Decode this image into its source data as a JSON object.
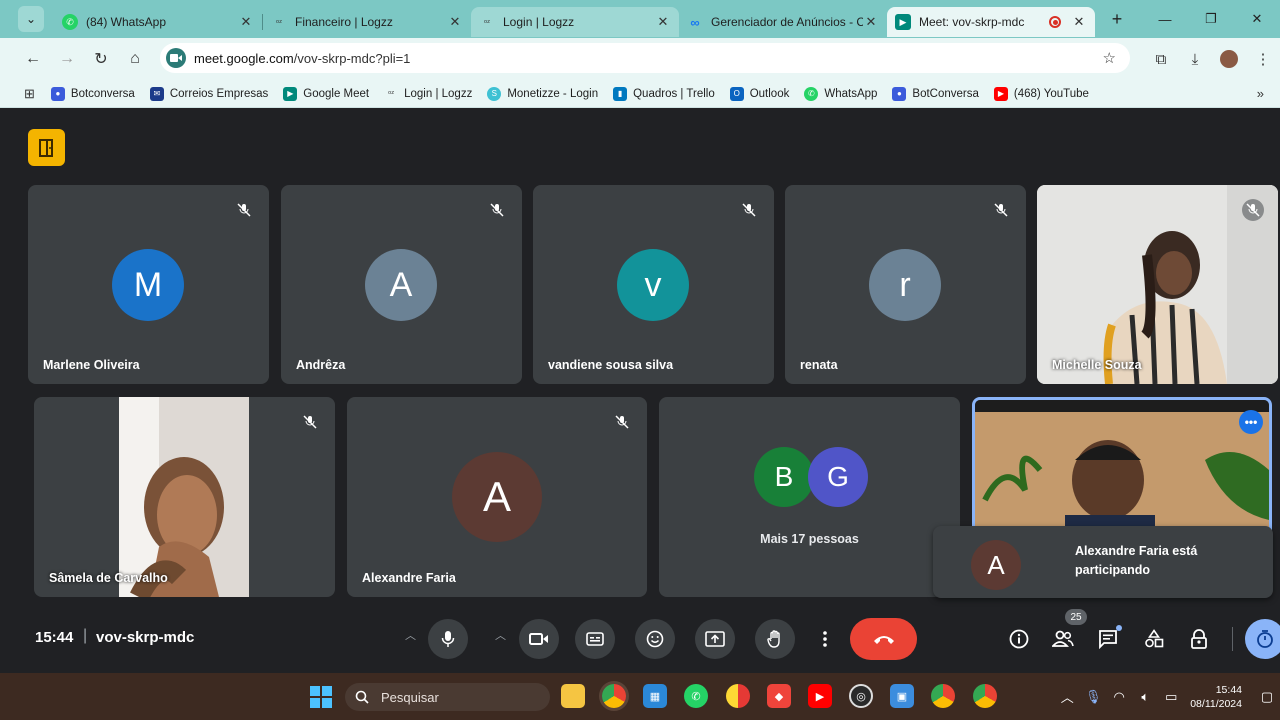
{
  "browser": {
    "tabs": [
      {
        "label": "(84) WhatsApp",
        "icon": "whatsapp-icon",
        "color": "#25d366"
      },
      {
        "label": "Financeiro | Logzz",
        "icon": "logzz-icon",
        "color": "#333333"
      },
      {
        "label": "Login | Logzz",
        "icon": "logzz-icon",
        "color": "#333333"
      },
      {
        "label": "Gerenciador de Anúncios - C",
        "icon": "meta-icon",
        "color": "#1877f2"
      },
      {
        "label": "Meet: vov-skrp-mdc",
        "icon": "google-meet-icon",
        "color": "#00897b"
      }
    ],
    "url_host": "meet.google.com",
    "url_path": "/vov-skrp-mdc?pli=1",
    "bookmarks": [
      {
        "label": "Botconversa",
        "color": "#3b5bdb"
      },
      {
        "label": "Correios Empresas",
        "color": "#1c3b8a"
      },
      {
        "label": "Google Meet",
        "color": "#00897b"
      },
      {
        "label": "Login | Logzz",
        "color": "#555555"
      },
      {
        "label": "Monetizze - Login",
        "color": "#3ec1d3"
      },
      {
        "label": "Quadros | Trello",
        "color": "#0079bf"
      },
      {
        "label": "Outlook",
        "color": "#0a64c0"
      },
      {
        "label": "WhatsApp",
        "color": "#25d366"
      },
      {
        "label": "BotConversa",
        "color": "#3b5bdb"
      },
      {
        "label": "(468) YouTube",
        "color": "#ff0000"
      }
    ]
  },
  "meet": {
    "participants_row1": [
      {
        "name": "Marlene Oliveira",
        "initial": "M",
        "avatar_color": "#1a73c9"
      },
      {
        "name": "Andrêza",
        "initial": "A",
        "avatar_color": "#6b8295"
      },
      {
        "name": "vandiene sousa silva",
        "initial": "v",
        "avatar_color": "#12939a"
      },
      {
        "name": "renata",
        "initial": "r",
        "avatar_color": "#6b8295"
      },
      {
        "name": "Michelle Souza",
        "initial": "",
        "avatar_color": ""
      }
    ],
    "participants_row2": [
      {
        "name": "Sâmela de Carvalho"
      },
      {
        "name": "Alexandre Faria",
        "initial": "A",
        "avatar_color": "#5c3a33"
      }
    ],
    "more_tile": {
      "avatars": [
        {
          "initial": "B",
          "color": "#188038"
        },
        {
          "initial": "G",
          "color": "#5055c8"
        }
      ],
      "label": "Mais 17 pessoas"
    },
    "toast": {
      "initial": "A",
      "text": "Alexandre Faria está participando"
    },
    "time": "15:44",
    "separator": "|",
    "meeting_code": "vov-skrp-mdc",
    "participant_count": "25"
  },
  "taskbar": {
    "search_label": "Pesquisar",
    "time": "15:44",
    "date": "08/11/2024"
  }
}
